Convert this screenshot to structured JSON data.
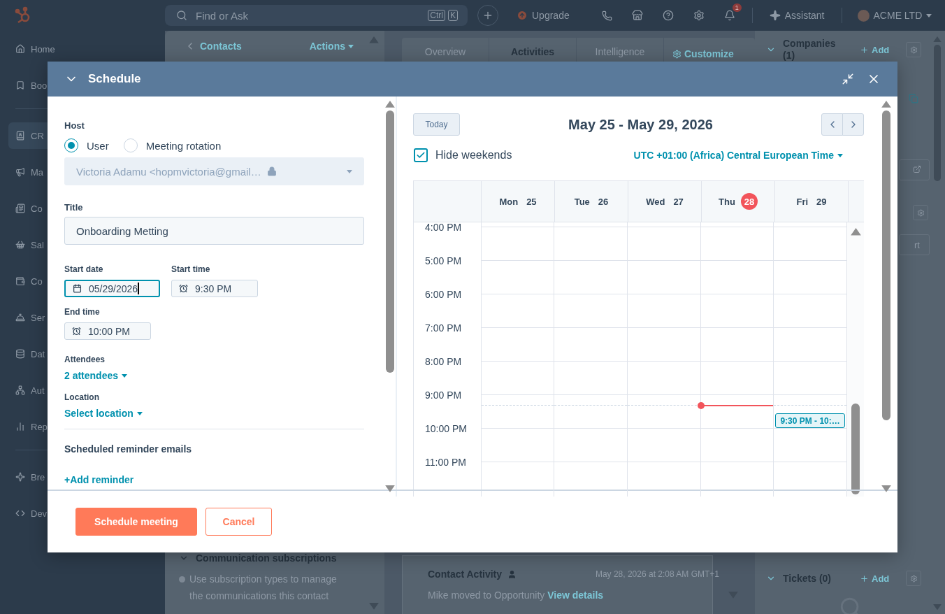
{
  "topbar": {
    "search": {
      "placeholder": "Find or Ask",
      "keys": [
        "Ctrl",
        "K"
      ]
    },
    "upgrade": "Upgrade",
    "notification_count": "1",
    "assistant": "Assistant",
    "account": "ACME LTD"
  },
  "sidebar": {
    "groups": [
      {
        "items": [
          {
            "label": "Home",
            "selected": false
          },
          {
            "label": "Boo",
            "selected": false
          }
        ]
      },
      {
        "items": [
          {
            "label": "CR",
            "selected": true
          },
          {
            "label": "Ma",
            "selected": false
          },
          {
            "label": "Co",
            "selected": false
          },
          {
            "label": "Sal",
            "selected": false
          },
          {
            "label": "Co",
            "selected": false
          },
          {
            "label": "Ser",
            "selected": false
          },
          {
            "label": "Dat",
            "selected": false
          },
          {
            "label": "Aut",
            "selected": false
          },
          {
            "label": "Rep",
            "selected": false
          }
        ]
      },
      {
        "items": [
          {
            "label": "Bre",
            "selected": false
          },
          {
            "label": "Dev",
            "selected": false
          }
        ]
      }
    ]
  },
  "record": {
    "back_link": "Contacts",
    "actions": "Actions",
    "subscriptions": {
      "title": "Communication subscriptions",
      "text": "Use subscription types to manage the communications this contact"
    }
  },
  "activity": {
    "tabs": [
      {
        "label": "Overview",
        "selected": false
      },
      {
        "label": "Activities",
        "selected": true
      },
      {
        "label": "Intelligence",
        "selected": false
      }
    ],
    "customize": "Customize",
    "card": {
      "title": "Contact Activity",
      "time": "May 28, 2026 at 2:08 AM GMT+1",
      "text": "Mike moved to Opportunity",
      "link": "View details"
    }
  },
  "right_panel": {
    "companies": {
      "title": "Companies (1)",
      "add": "Add"
    },
    "fragment_button": "rt",
    "tickets": {
      "title": "Tickets (0)",
      "add": "Add"
    }
  },
  "modal": {
    "title": "Schedule",
    "form": {
      "host": {
        "label": "Host",
        "options": [
          {
            "label": "User",
            "selected": true
          },
          {
            "label": "Meeting rotation",
            "selected": false
          }
        ],
        "value": "Victoria Adamu <hopmvictoria@gmail…",
        "disabled": true
      },
      "title_field": {
        "label": "Title",
        "value": "Onboarding Metting"
      },
      "start_date": {
        "label": "Start date",
        "value": "05/29/2026",
        "focused": true
      },
      "start_time": {
        "label": "Start time",
        "value": "9:30 PM",
        "focused": false
      },
      "end_time": {
        "label": "End time",
        "value": "10:00 PM",
        "focused": false
      },
      "attendees": {
        "label": "Attendees",
        "value": "2 attendees"
      },
      "location": {
        "label": "Location",
        "value": "Select location"
      },
      "reminders": {
        "title": "Scheduled reminder emails",
        "add": "+Add reminder"
      }
    },
    "calendar": {
      "today_button": "Today",
      "range": "May 25 - May 29, 2026",
      "hide_weekends": {
        "label": "Hide weekends",
        "checked": true
      },
      "timezone": "UTC +01:00 (Africa) Central European Time",
      "days": [
        {
          "weekday": "Mon",
          "date": "25",
          "today": false
        },
        {
          "weekday": "Tue",
          "date": "26",
          "today": false
        },
        {
          "weekday": "Wed",
          "date": "27",
          "today": false
        },
        {
          "weekday": "Thu",
          "date": "28",
          "today": true
        },
        {
          "weekday": "Fri",
          "date": "29",
          "today": false,
          "events": [
            {
              "label": "9:30 PM - 10:…"
            }
          ]
        }
      ],
      "hours": [
        "4:00 PM",
        "5:00 PM",
        "6:00 PM",
        "7:00 PM",
        "8:00 PM",
        "9:00 PM",
        "10:00 PM",
        "11:00 PM"
      ]
    },
    "footer": {
      "primary": "Schedule meeting",
      "secondary": "Cancel"
    }
  }
}
